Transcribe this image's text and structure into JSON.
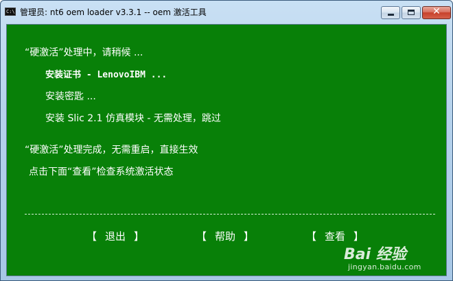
{
  "window": {
    "title": "管理员:  nt6 oem loader v3.3.1  -- oem 激活工具",
    "icon": "console-icon",
    "icon_text": "C:\\",
    "close_glyph": "✕"
  },
  "console": {
    "background": "#088008",
    "text_color": "#ffffff",
    "lines": [
      {
        "text": "“硬激活”处理中，请稍候 ..."
      },
      {
        "text": "安装证书 - LenovoIBM ..."
      },
      {
        "text": "安装密匙 ..."
      },
      {
        "text": "安装 Slic 2.1 仿真模块 - 无需处理，跳过"
      },
      {
        "text": "“硬激活”处理完成，无需重启，直接生效"
      },
      {
        "text": "点击下面“查看”检查系统激活状态"
      }
    ],
    "divider": "-----------------------------------------------------------------------------------------"
  },
  "menu": {
    "exit_label": "退出",
    "help_label": "帮助",
    "view_label": "查看",
    "left_bracket": "【",
    "right_bracket": "】"
  },
  "watermark": {
    "logo_text": "Bai 经验",
    "site": "jingyan.baidu.com"
  }
}
